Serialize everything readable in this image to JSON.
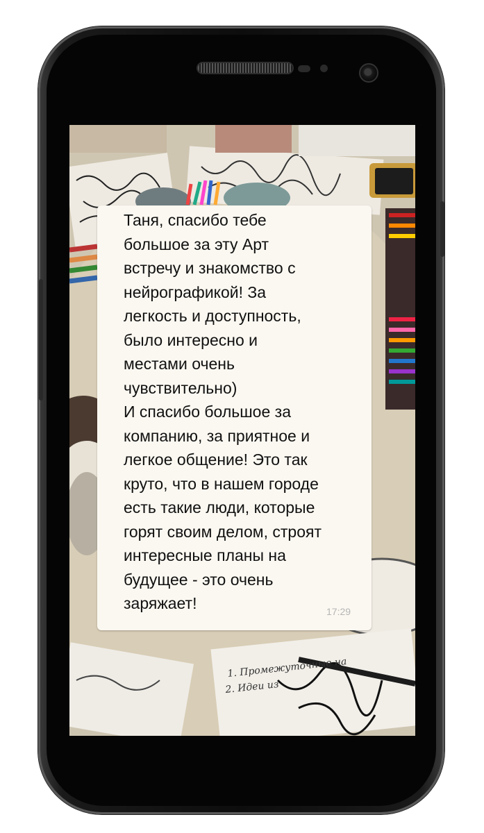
{
  "message": {
    "text": "Таня, спасибо тебе\nбольшое за эту Арт\nвстречу и знакомство с\nнейрографикой! За\nлегкость и доступность,\nбыло интересно и\nместами очень\nчувствительно)\nИ спасибо большое за\nкомпанию, за приятное и\nлегкое общение! Это так\nкруто, что в нашем городе\nесть такие люди, которые\nгорят своим делом, строят\nинтересные планы на\nбудущее - это очень\nзаряжает!",
    "time": "17:29"
  },
  "photo_note": {
    "line1": "1. Промежуточные на",
    "line2": "2. Идеи из"
  },
  "colors": {
    "bubble": "#fbf8f1",
    "phone_body": "#0d0d0d",
    "timestamp": "#b5b5b5"
  }
}
